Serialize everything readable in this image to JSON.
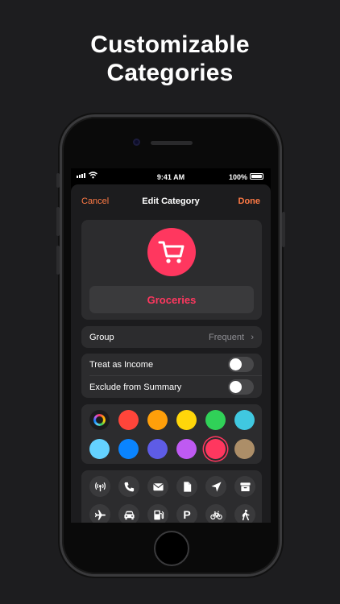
{
  "headline": {
    "line1": "Customizable",
    "line2": "Categories"
  },
  "status_bar": {
    "time": "9:41 AM",
    "battery": "100%"
  },
  "nav": {
    "cancel": "Cancel",
    "title": "Edit Category",
    "done": "Done"
  },
  "category": {
    "icon": "cart-icon",
    "name": "Groceries",
    "color": "#ff375f"
  },
  "group_row": {
    "label": "Group",
    "value": "Frequent"
  },
  "toggles": [
    {
      "label": "Treat as Income",
      "on": false
    },
    {
      "label": "Exclude from Summary",
      "on": false
    }
  ],
  "colors": [
    "custom",
    "#ff453a",
    "#ff9f0a",
    "#ffd60a",
    "#30d158",
    "#40c8e0",
    "#64d2ff",
    "#0a84ff",
    "#5e5ce6",
    "#bf5af2",
    "#ff375f",
    "#ac8e68"
  ],
  "selected_color": "#ff375f",
  "icons": [
    "antenna-icon",
    "phone-icon",
    "envelope-icon",
    "document-icon",
    "location-arrow-icon",
    "archive-box-icon",
    "airplane-icon",
    "car-icon",
    "fuel-pump-icon",
    "parking-icon",
    "bicycle-icon",
    "walking-icon"
  ],
  "icon_labels": {
    "parking": "P"
  }
}
